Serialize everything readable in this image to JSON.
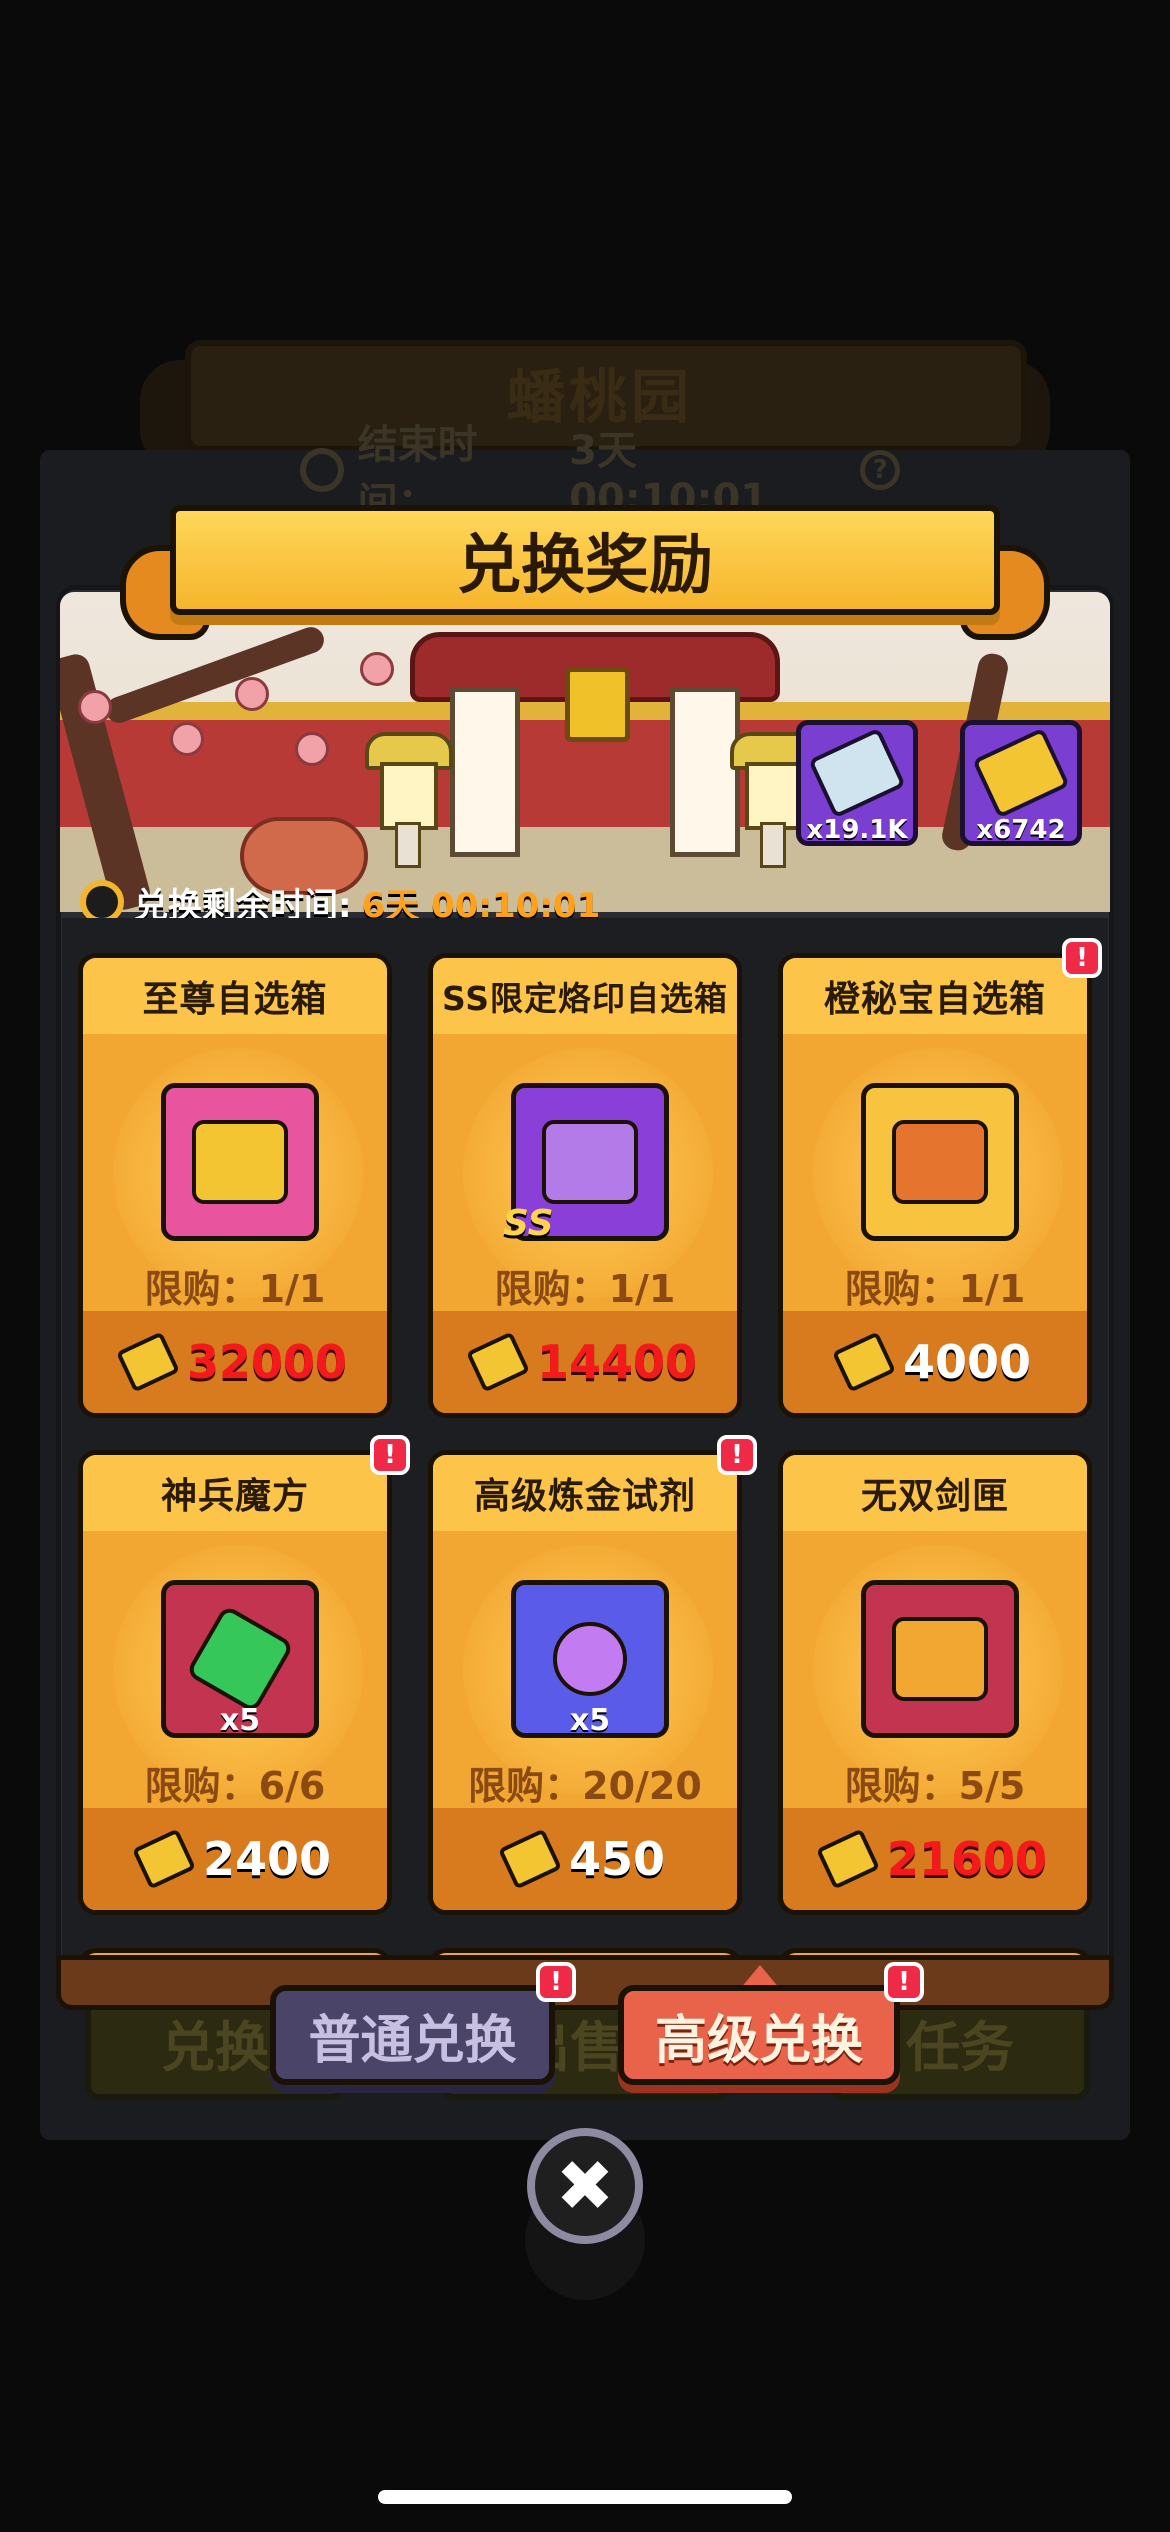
{
  "background": {
    "event_title": "蟠桃园",
    "end_time_label": "结束时间：",
    "end_time_value": "3天 00:10:01",
    "bottom_buttons": [
      "兑换",
      "出售",
      "任务"
    ]
  },
  "popup": {
    "title": "兑换奖励",
    "currencies": [
      {
        "icon": "silver-ticket-icon",
        "amount": "x19.1K"
      },
      {
        "icon": "gold-ticket-icon",
        "amount": "x6742"
      }
    ],
    "remaining_label": "兑换剩余时间:",
    "remaining_time": "6天 00:10:01",
    "items": [
      {
        "name": "至尊自选箱",
        "icon": "pink-chest-icon",
        "limit": "限购：1/1",
        "price": "32000",
        "price_color": "red",
        "alert": false
      },
      {
        "name": "SS限定烙印自选箱",
        "icon": "purple-skull-chest-icon",
        "limit": "限购：1/1",
        "price": "14400",
        "price_color": "red",
        "alert": false,
        "badge": "SS"
      },
      {
        "name": "橙秘宝自选箱",
        "icon": "orange-chest-icon",
        "limit": "限购：1/1",
        "price": "4000",
        "price_color": "white",
        "alert": true
      },
      {
        "name": "神兵魔方",
        "icon": "green-cube-icon",
        "limit": "限购：6/6",
        "price": "2400",
        "price_color": "white",
        "alert": true,
        "qty": "x5"
      },
      {
        "name": "高级炼金试剂",
        "icon": "potion-flask-icon",
        "limit": "限购：20/20",
        "price": "450",
        "price_color": "white",
        "alert": true,
        "qty": "x5"
      },
      {
        "name": "无双剑匣",
        "icon": "sword-case-icon",
        "limit": "限购：5/5",
        "price": "21600",
        "price_color": "red",
        "alert": false
      }
    ],
    "tabs": {
      "normal": "普通兑换",
      "advanced": "高级兑换",
      "active": "advanced"
    },
    "alert_glyph": "!",
    "close_glyph": "✖"
  },
  "colors": {
    "card_orange": "#f3a733",
    "price_red": "#f21a1a",
    "timer_orange": "#ffa11a",
    "alert_red": "#ee2a46",
    "active_tab": "#e8634a",
    "inactive_tab": "#4a4468"
  }
}
